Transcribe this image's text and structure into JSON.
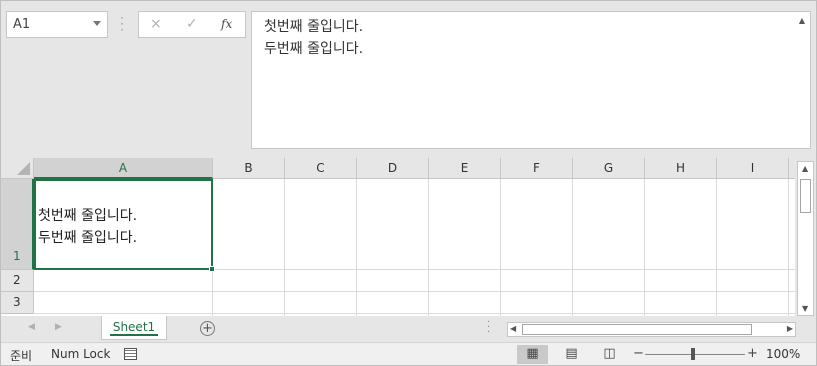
{
  "name_box": {
    "value": "A1"
  },
  "formula_bar": {
    "cancel_icon": "×",
    "enter_icon": "✓",
    "function_label": "fx",
    "lines": [
      "첫번째 줄입니다.",
      "두번째 줄입니다."
    ]
  },
  "grid": {
    "columns": [
      "A",
      "B",
      "C",
      "D",
      "E",
      "F",
      "G",
      "H",
      "I"
    ],
    "selected_column": "A",
    "rows": [
      "1",
      "2",
      "3"
    ],
    "selected_row": "1",
    "active_cell": {
      "ref": "A1",
      "lines": [
        "첫번째 줄입니다.",
        "두번째 줄입니다."
      ]
    }
  },
  "sheet_tabs": {
    "tabs": [
      "Sheet1"
    ],
    "active": "Sheet1",
    "add_label": "+"
  },
  "status_bar": {
    "ready": "준비",
    "num_lock": "Num Lock",
    "zoom_minus": "−",
    "zoom_plus": "+",
    "zoom": "100%"
  },
  "colors": {
    "accent": "#217346",
    "header_bg": "#e6e6e6",
    "gridline": "#dadada"
  }
}
